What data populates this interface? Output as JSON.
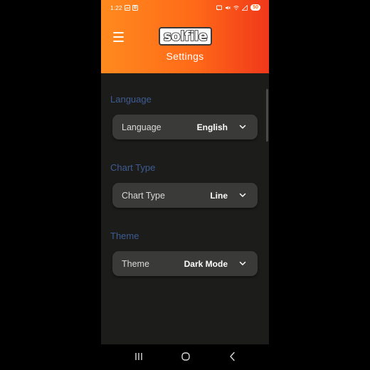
{
  "status_bar": {
    "time": "1:22",
    "app_badge": "B",
    "battery": "50"
  },
  "header": {
    "logo_text": "solfile",
    "title": "Settings"
  },
  "sections": [
    {
      "heading": "Language",
      "label": "Language",
      "value": "English"
    },
    {
      "heading": "Chart Type",
      "label": "Chart Type",
      "value": "Line"
    },
    {
      "heading": "Theme",
      "label": "Theme",
      "value": "Dark Mode"
    }
  ],
  "colors": {
    "header_gradient_start": "#ff8a1e",
    "header_gradient_end": "#f0381a",
    "background": "#1c1d1b",
    "card": "#3a3b38",
    "section_heading": "#3e5b92"
  },
  "icons": {
    "menu": "hamburger-menu-icon",
    "dropdown": "chevron-down-icon",
    "nav_recents": "recents-icon",
    "nav_home": "home-icon",
    "nav_back": "back-icon"
  }
}
